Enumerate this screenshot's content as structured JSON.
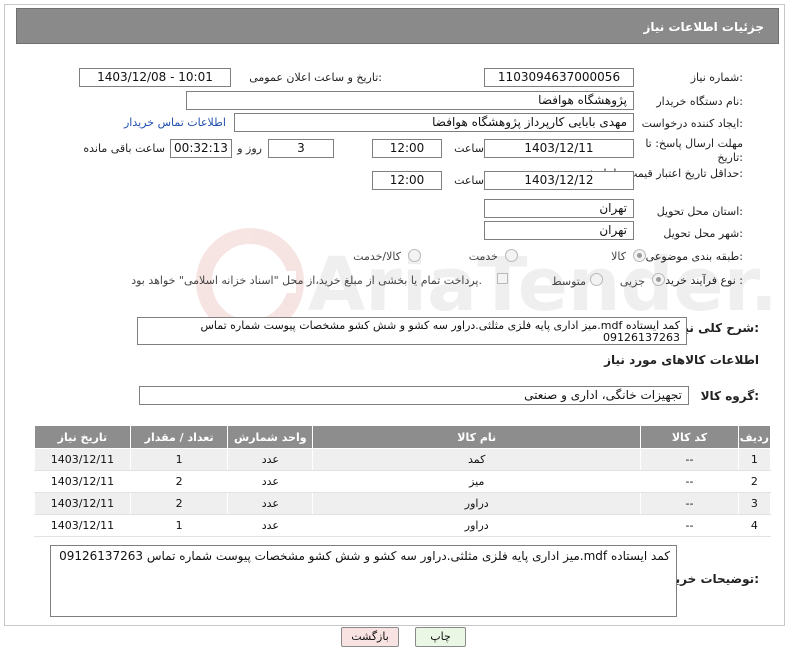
{
  "page_title": "جزئیات اطلاعات نیاز",
  "fields": {
    "need_number_label": "شماره نیاز:",
    "need_number": "1103094637000056",
    "announce_label": "تاریخ و ساعت اعلان عمومی:",
    "announce_value": "1403/12/08 - 10:01",
    "buyer_org_label": "نام دستگاه خریدار:",
    "buyer_org": "پژوهشگاه هوافضا",
    "creator_label": "ایجاد کننده درخواست:",
    "creator": "مهدی بابایی کارپرداز پژوهشگاه هوافضا",
    "contact_link": "اطلاعات تماس خریدار",
    "reply_deadline_label": "مهلت ارسال پاسخ: تا تاریخ:",
    "reply_date": "1403/12/11",
    "time_label": "ساعت",
    "reply_time": "12:00",
    "days_value": "3",
    "days_label": "روز و",
    "remaining_time": "00:32:13",
    "remaining_label": "ساعت باقی مانده",
    "price_validity_label": "حداقل تاریخ اعتبار قیمت: تا تاریخ:",
    "price_date": "1403/12/12",
    "price_time": "12:00",
    "province_label": "استان محل تحویل:",
    "province": "تهران",
    "city_label": "شهر محل تحویل:",
    "city": "تهران",
    "category_label": "طبقه بندی موضوعی:",
    "category_options": [
      "کالا",
      "خدمت",
      "کالا/خدمت"
    ],
    "purchase_type_label": "نوع فرآیند خرید :",
    "purchase_options": [
      "جزیی",
      "متوسط"
    ],
    "payment_note": "پرداخت تمام یا بخشی از مبلغ خرید،از محل \"اسناد خزانه اسلامی\" خواهد بود."
  },
  "summary": {
    "label": "شرح کلی نیاز:",
    "text": "کمد ایستاده mdf.میز اداری پایه فلزی مثلثی.دراور سه کشو و شش کشو مشخصات پیوست    شماره تماس 09126137263"
  },
  "goods_section_title": "اطلاعات کالاهای مورد نیاز",
  "goods_group_label": "گروه کالا:",
  "goods_group": "تجهیزات خانگی، اداری و صنعتی",
  "table": {
    "headers": [
      "ردیف",
      "کد کالا",
      "نام کالا",
      "واحد شمارش",
      "تعداد / مقدار",
      "تاریخ نیاز"
    ],
    "rows": [
      [
        "1",
        "--",
        "کمد",
        "عدد",
        "1",
        "1403/12/11"
      ],
      [
        "2",
        "--",
        "میز",
        "عدد",
        "2",
        "1403/12/11"
      ],
      [
        "3",
        "--",
        "دراور",
        "عدد",
        "2",
        "1403/12/11"
      ],
      [
        "4",
        "--",
        "دراور",
        "عدد",
        "1",
        "1403/12/11"
      ]
    ]
  },
  "buyer_notes": {
    "label": "توضیحات خریدار:",
    "text": "کمد ایستاده mdf.میز اداری پایه فلزی مثلثی.دراور سه کشو و شش کشو مشخصات پیوست    شماره تماس 09126137263"
  },
  "buttons": {
    "print": "چاپ",
    "back": "بازگشت"
  },
  "watermark_text": "AriaTender.neT",
  "colors": {
    "header_bg": "#8a8a8a",
    "link": "#1f4fb0",
    "print_btn": "#e9f7e4",
    "back_btn": "#f9e2e2"
  }
}
